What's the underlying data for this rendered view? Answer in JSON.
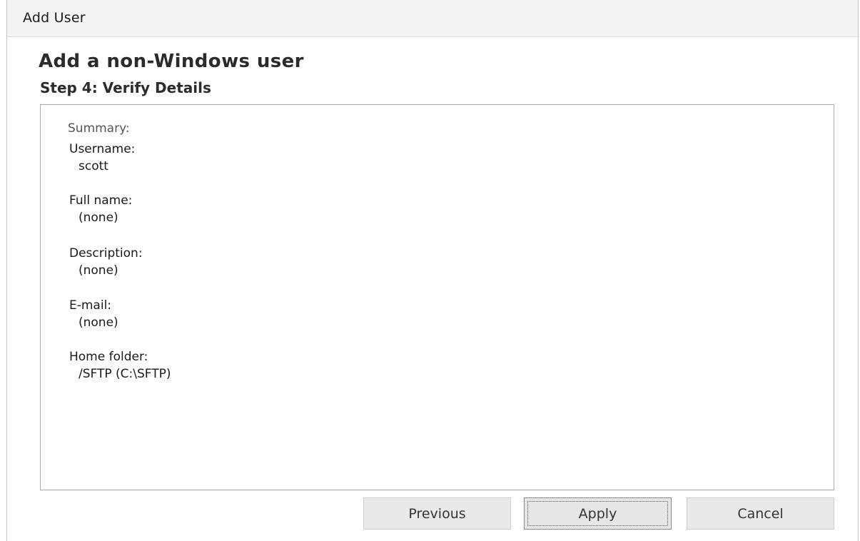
{
  "window": {
    "title": "Add User"
  },
  "wizard": {
    "heading": "Add a non-Windows user",
    "step": "Step 4: Verify Details"
  },
  "summary": {
    "title": "Summary:",
    "fields": [
      {
        "label": "Username:",
        "value": "scott"
      },
      {
        "label": "Full name:",
        "value": "(none)"
      },
      {
        "label": "Description:",
        "value": "(none)"
      },
      {
        "label": "E-mail:",
        "value": "(none)"
      },
      {
        "label": "Home folder:",
        "value": "/SFTP (C:\\SFTP)"
      }
    ]
  },
  "buttons": {
    "previous": "Previous",
    "apply": "Apply",
    "cancel": "Cancel"
  }
}
